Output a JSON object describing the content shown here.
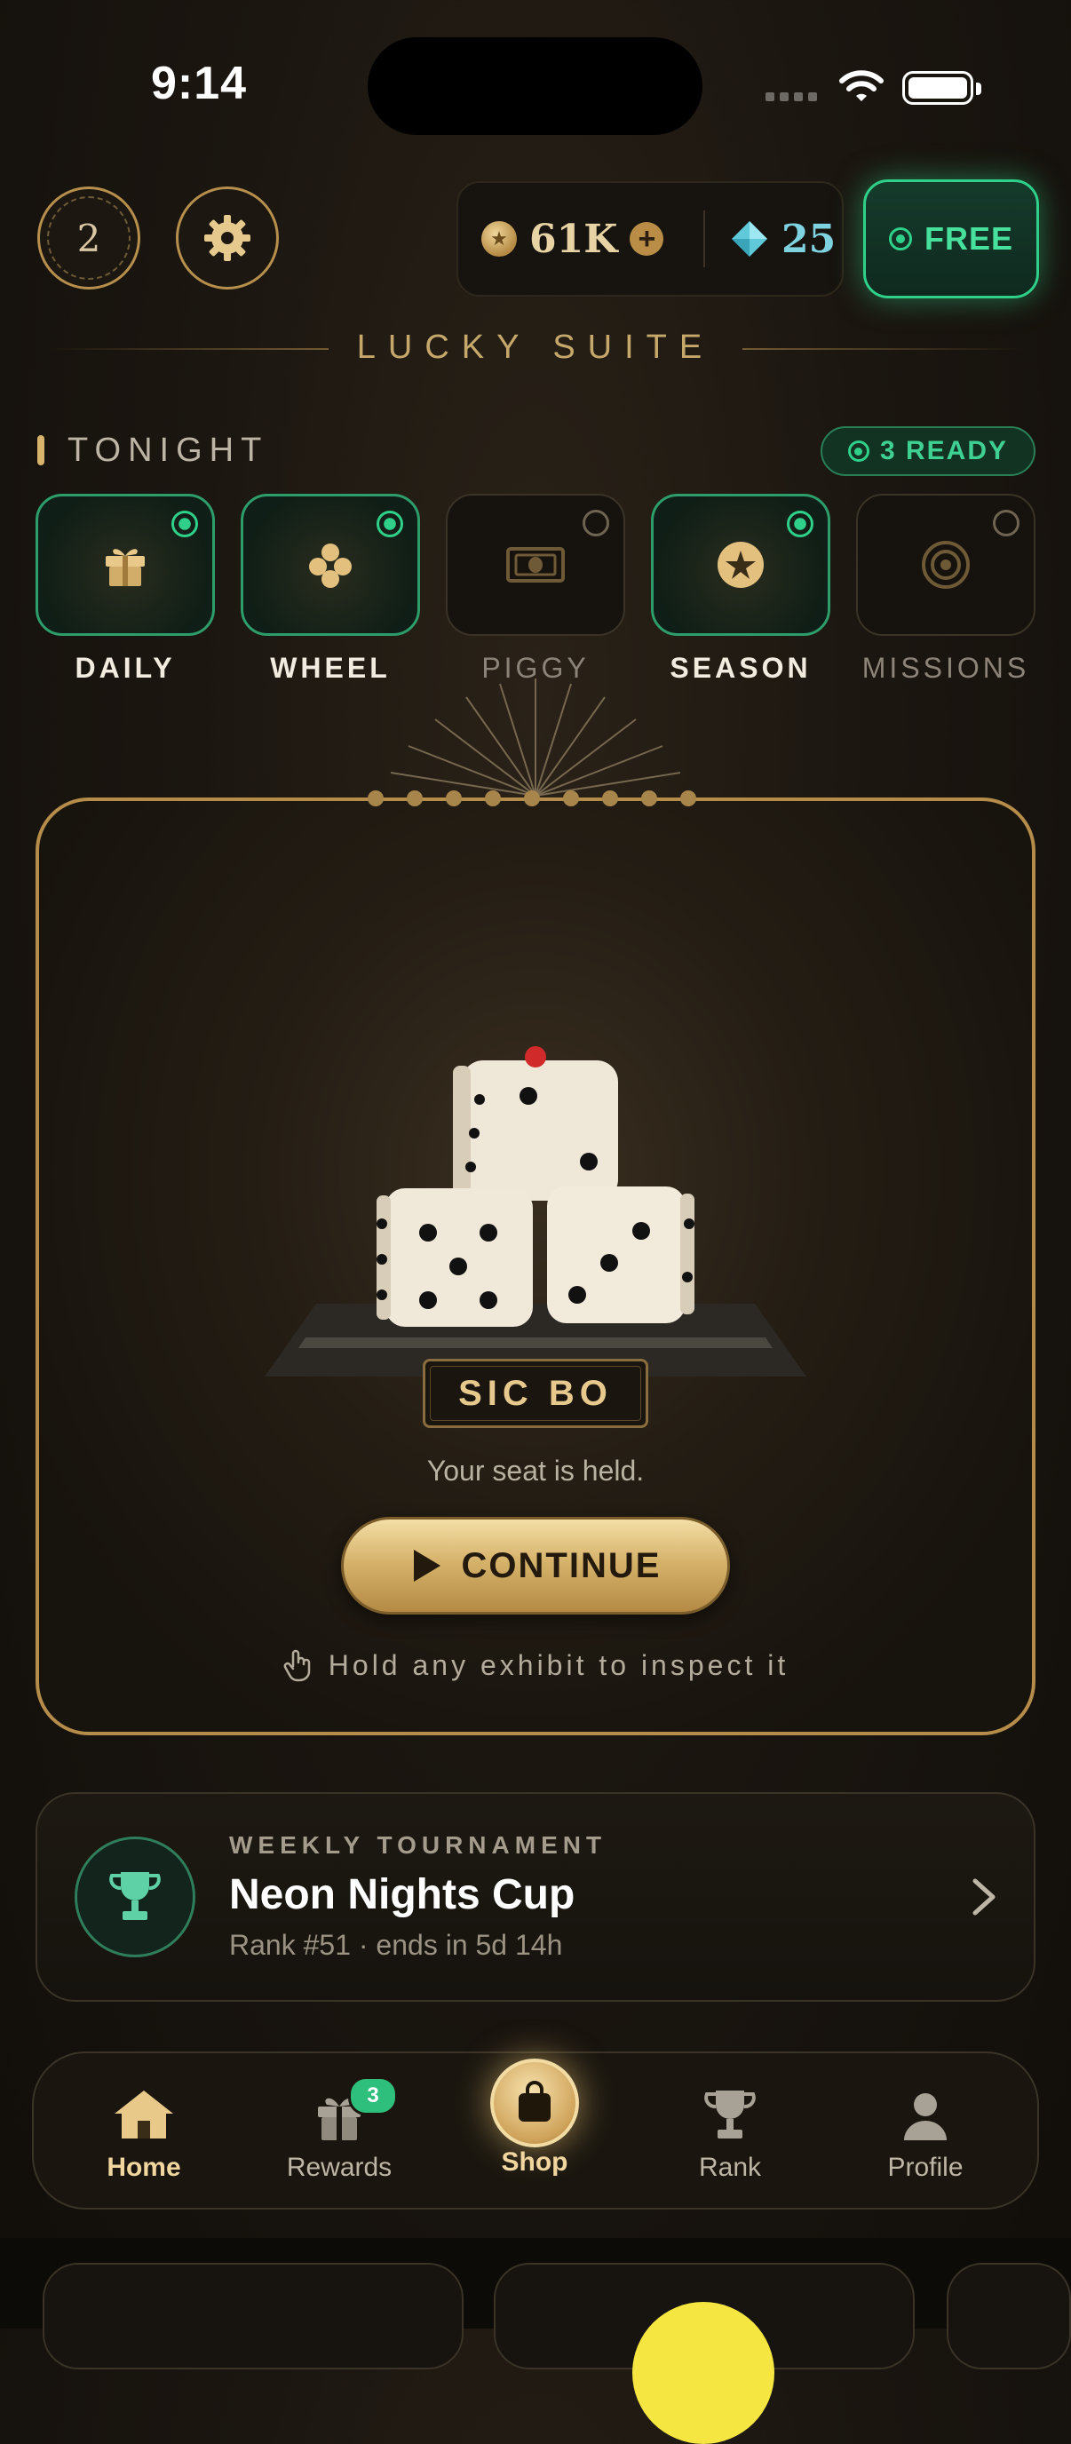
{
  "status_bar": {
    "time": "9:14"
  },
  "header": {
    "level": "2",
    "coins": "61K",
    "gems": "25",
    "free_label": "FREE"
  },
  "suite_title": "LUCKY SUITE",
  "tonight": {
    "title": "TONIGHT",
    "ready_label": "3 READY",
    "tiles": [
      {
        "label": "DAILY",
        "icon": "gift-icon",
        "active": true
      },
      {
        "label": "WHEEL",
        "icon": "clover-icon",
        "active": true
      },
      {
        "label": "PIGGY",
        "icon": "banknote-icon",
        "active": false
      },
      {
        "label": "SEASON",
        "icon": "star-coin-icon",
        "active": true
      },
      {
        "label": "MISSIONS",
        "icon": "target-icon",
        "active": false
      }
    ]
  },
  "featured": {
    "game_title": "SIC BO",
    "seat_text": "Your seat is held.",
    "continue_label": "CONTINUE",
    "hint": "Hold any exhibit to inspect it"
  },
  "tournament": {
    "kicker": "WEEKLY TOURNAMENT",
    "title": "Neon Nights Cup",
    "subtitle": "Rank #51 · ends in 5d 14h"
  },
  "nav": {
    "items": [
      {
        "label": "Home",
        "icon": "home-icon",
        "active": true
      },
      {
        "label": "Rewards",
        "icon": "gift-icon",
        "active": false,
        "badge": "3"
      },
      {
        "label": "Shop",
        "icon": "shopping-bag-icon",
        "active": true
      },
      {
        "label": "Rank",
        "icon": "trophy-icon",
        "active": false
      },
      {
        "label": "Profile",
        "icon": "person-icon",
        "active": false
      }
    ]
  },
  "colors": {
    "gold": "#b58c4a",
    "green": "#2fd08a",
    "background": "#1b1610"
  }
}
